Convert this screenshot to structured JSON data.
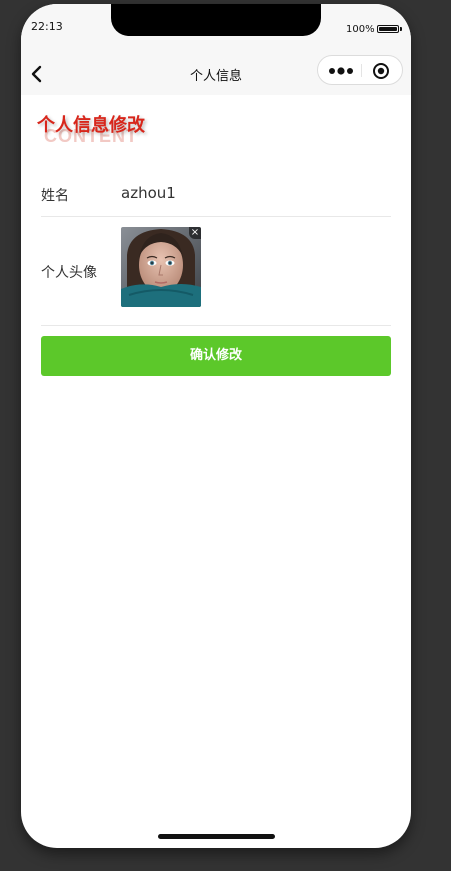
{
  "status_bar": {
    "time": "22:13",
    "battery": "100%"
  },
  "nav": {
    "title": "个人信息"
  },
  "section": {
    "title": "个人信息修改",
    "shadow_text": "CONTENT"
  },
  "form": {
    "name_label": "姓名",
    "name_value": "azhou1",
    "avatar_label": "个人头像",
    "avatar_remove": "×"
  },
  "actions": {
    "confirm_label": "确认修改"
  },
  "colors": {
    "accent_red": "#d8261b",
    "button_green": "#5cc82a",
    "frame": "#333333"
  },
  "icons": {
    "back": "chevron-left-icon",
    "more": "more-dots-icon",
    "close": "target-circle-icon",
    "avatar": "avatar-photo"
  }
}
